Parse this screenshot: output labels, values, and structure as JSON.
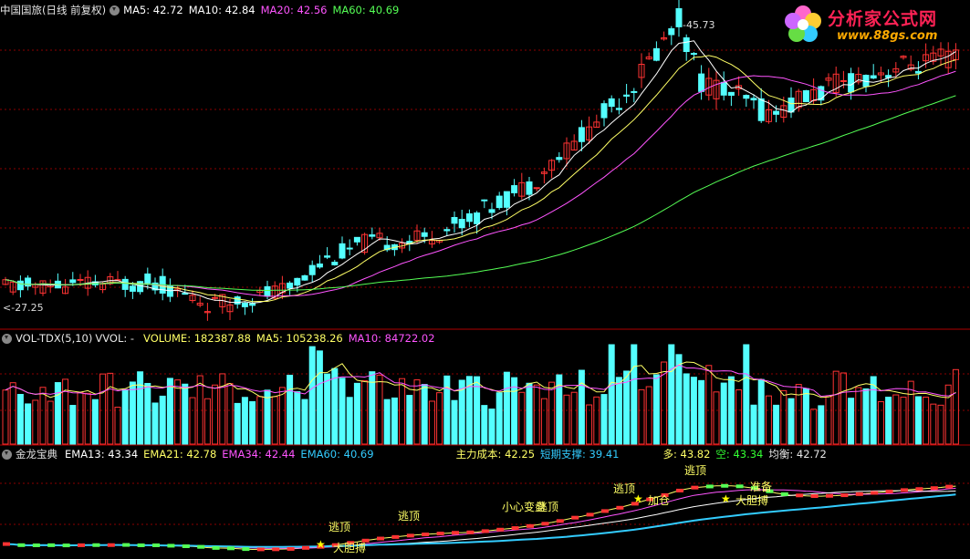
{
  "price_panel": {
    "title": "中国国旅(日线 前复权)",
    "ma5": "MA5: 42.72",
    "ma10": "MA10: 42.84",
    "ma20": "MA20: 42.56",
    "ma60": "MA60: 40.69",
    "high_label": "45.73",
    "low_label": "27.25"
  },
  "volume_panel": {
    "name": "VOL-TDX(5,10)",
    "vvol": "VVOL: -",
    "volume": "VOLUME: 182387.88",
    "ma5": "MA5: 105238.26",
    "ma10": "MA10: 84722.02"
  },
  "indicator_panel": {
    "name": "金龙宝典",
    "ema13": "EMA13: 43.34",
    "ema21": "EMA21: 42.78",
    "ema34": "EMA34: 42.44",
    "ema60": "EMA60: 40.69",
    "main_cost_label": "主力成本: 42.25",
    "short_support_label": "短期支撑: 39.41",
    "long_label": "多: 43.82",
    "short_label": "空: 43.34",
    "balance_label": "均衡: 42.72",
    "signals": [
      "逃顶",
      "大胆搏",
      "逃顶",
      "逃顶",
      "小心变盘",
      "逃顶",
      "加仓",
      "逃顶",
      "准备",
      "大胆搏"
    ]
  },
  "logo": {
    "text": "分析家公式网",
    "url_text": "www.88gs.com"
  },
  "colors": {
    "up": "#ff3333",
    "down": "#54ffff",
    "ma5": "#ffffff",
    "ma10": "#ffff66",
    "ma20": "#ff55ff",
    "ma60": "#55ff55",
    "grid": "#8b0000"
  },
  "chart_data": {
    "type": "candlestick",
    "price_range": [
      27.25,
      45.73
    ],
    "series": [
      {
        "name": "MA5",
        "last": 42.72
      },
      {
        "name": "MA10",
        "last": 42.84
      },
      {
        "name": "MA20",
        "last": 42.56
      },
      {
        "name": "MA60",
        "last": 40.69
      }
    ]
  }
}
